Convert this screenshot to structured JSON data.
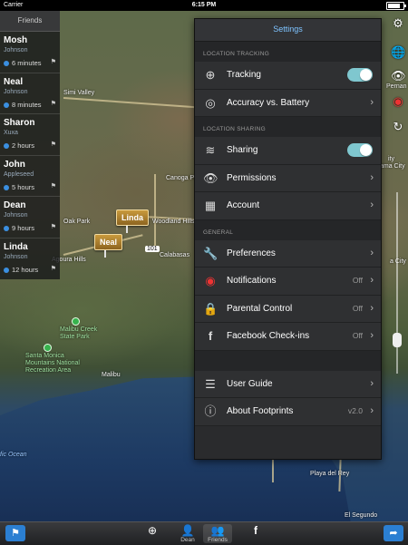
{
  "status_bar": {
    "carrier": "Carrier",
    "time": "6:15 PM",
    "battery_percent": 90
  },
  "friends_panel": {
    "title": "Friends",
    "friends": [
      {
        "name": "Mosh",
        "subtitle": "Johnson",
        "time": "6 minutes"
      },
      {
        "name": "Neal",
        "subtitle": "Johnson",
        "time": "8 minutes"
      },
      {
        "name": "Sharon",
        "subtitle": "Xuxa",
        "time": "2 hours"
      },
      {
        "name": "John",
        "subtitle": "Appleseed",
        "time": "5 hours"
      },
      {
        "name": "Dean",
        "subtitle": "Johnson",
        "time": "9 hours"
      },
      {
        "name": "Linda",
        "subtitle": "Johnson",
        "time": "12 hours"
      }
    ]
  },
  "map": {
    "pins": {
      "linda": "Linda",
      "neal": "Neal"
    },
    "labels": {
      "simi_valley": "Simi Valley",
      "canoga_park": "Canoga Park",
      "oak_park": "Oak Park",
      "woodland_hills": "Woodland Hills",
      "calabasas": "Calabasas",
      "agoura_hills": "Agoura Hills",
      "malibu_creek": "Malibu Creek State Park",
      "santa_monica_mts": "Santa Monica Mountains National Recreation Area",
      "malibu": "Malibu",
      "ocean": "fic Ocean",
      "playa_del_rey": "Playa del Rey",
      "el_segundo": "El Segundo",
      "route": "101",
      "pernan": "Pernan",
      "la_city": "ity",
      "ama_city": "ama City",
      "a_city": "a City"
    }
  },
  "settings": {
    "title": "Settings",
    "location_tracking": {
      "header": "Location Tracking",
      "tracking": {
        "label": "Tracking",
        "on": true
      },
      "accuracy": {
        "label": "Accuracy vs. Battery"
      }
    },
    "location_sharing": {
      "header": "Location Sharing",
      "sharing": {
        "label": "Sharing",
        "on": true
      },
      "permissions": {
        "label": "Permissions"
      },
      "account": {
        "label": "Account"
      }
    },
    "general": {
      "header": "General",
      "preferences": {
        "label": "Preferences"
      },
      "notifications": {
        "label": "Notifications",
        "value": "Off"
      },
      "parental": {
        "label": "Parental Control",
        "value": "Off"
      },
      "facebook": {
        "label": "Facebook Check-ins",
        "value": "Off"
      }
    },
    "misc": {
      "user_guide": {
        "label": "User Guide"
      },
      "about": {
        "label": "About Footprints",
        "value": "v2.0"
      }
    }
  },
  "bottom_bar": {
    "dean_label": "Dean",
    "friends_label": "Friends"
  },
  "colors": {
    "accent": "#7ec3ff",
    "toggle_on": "#7fc7cf",
    "pin": "#b8862e"
  }
}
